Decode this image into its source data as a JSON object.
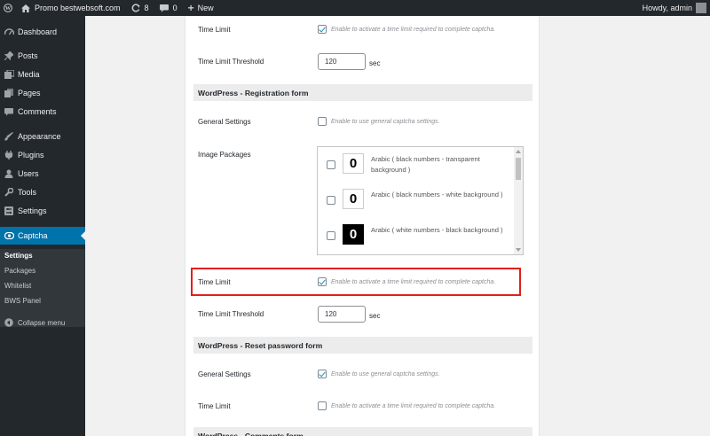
{
  "adminbar": {
    "site_name": "Promo bestwebsoft.com",
    "updates_count": "8",
    "comments_count": "0",
    "new_label": "New",
    "greeting": "Howdy, admin"
  },
  "sidebar": {
    "items": [
      {
        "label": "Dashboard",
        "icon": "dashboard-icon"
      },
      {
        "label": "Posts",
        "icon": "pin-icon"
      },
      {
        "label": "Media",
        "icon": "media-icon"
      },
      {
        "label": "Pages",
        "icon": "pages-icon"
      },
      {
        "label": "Comments",
        "icon": "comment-icon"
      },
      {
        "label": "Appearance",
        "icon": "brush-icon"
      },
      {
        "label": "Plugins",
        "icon": "plugin-icon"
      },
      {
        "label": "Users",
        "icon": "users-icon"
      },
      {
        "label": "Tools",
        "icon": "wrench-icon"
      },
      {
        "label": "Settings",
        "icon": "settings-icon"
      },
      {
        "label": "Captcha",
        "icon": "captcha-icon"
      }
    ],
    "submenu": [
      "Settings",
      "Packages",
      "Whitelist",
      "BWS Panel"
    ],
    "collapse_label": "Collapse menu"
  },
  "form": {
    "time_limit_label": "Time Limit",
    "time_limit_desc": "Enable to activate a time limit required to complete captcha.",
    "threshold_label": "Time Limit Threshold",
    "threshold_value": "120",
    "threshold_unit": "sec",
    "general_settings_label": "General Settings",
    "general_settings_desc": "Enable to use general captcha settings.",
    "image_packages_label": "Image Packages",
    "sections": {
      "registration": "WordPress - Registration form",
      "reset_password": "WordPress - Reset password form",
      "comments": "WordPress - Comments form"
    },
    "packages": [
      {
        "digit": "0",
        "name": "Arabic ( black numbers - transparent background )"
      },
      {
        "digit": "0",
        "name": "Arabic ( black numbers - white background )"
      },
      {
        "digit": "0",
        "name": "Arabic ( white numbers - black background )"
      }
    ]
  },
  "colors": {
    "adminbar_bg": "#23282d",
    "active_menu": "#0073aa",
    "highlight_border": "#e0201a"
  }
}
